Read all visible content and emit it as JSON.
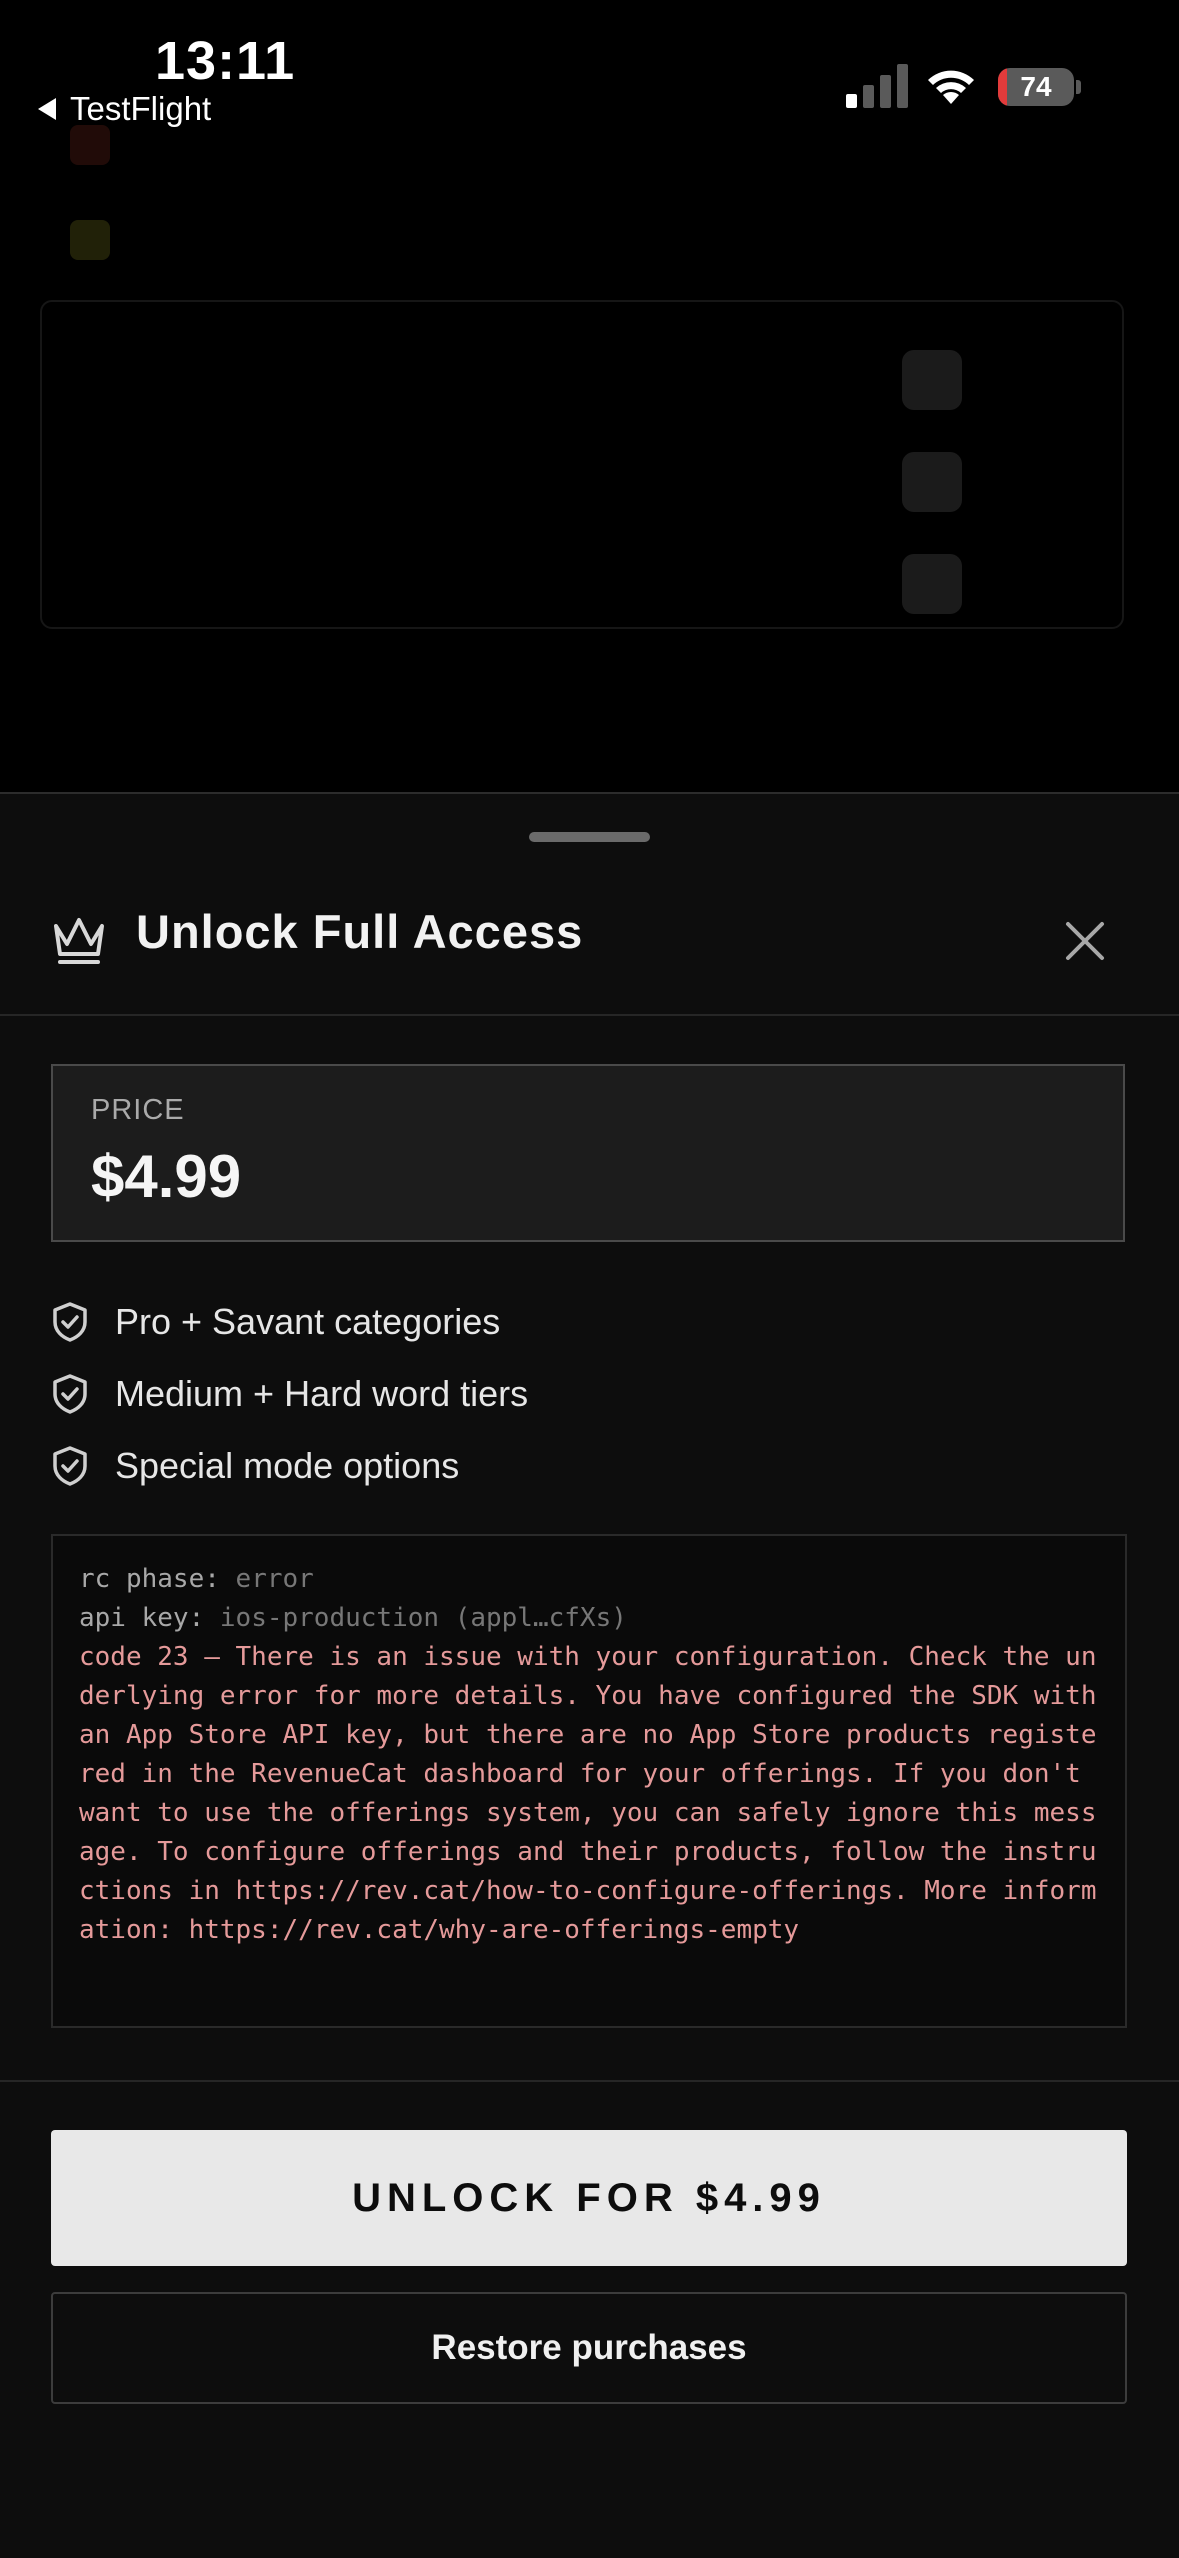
{
  "status_bar": {
    "time": "13:11",
    "back_app": "TestFlight",
    "battery_level": "74",
    "battery_fraction": 0.74,
    "icons": [
      "cellular-signal-icon",
      "wifi-icon",
      "battery-icon"
    ]
  },
  "sheet": {
    "title": "Unlock Full Access",
    "price_label": "PRICE",
    "price": "$4.99",
    "features": [
      "Pro + Savant categories",
      "Medium + Hard word tiers",
      "Special mode options"
    ],
    "debug": {
      "phase_key": "rc phase:",
      "phase_value": "error",
      "api_key_label": "api key:",
      "api_key_value": "ios-production (appl…cfXs)",
      "error_message": "code 23 — There is an issue with your configuration. Check the underlying error for more details. You have configured the SDK with an App Store API key, but there are no App Store products registered in the RevenueCat dashboard for your offerings. If you don't want to use the offerings system, you can safely ignore this message. To configure offerings and their products, follow the instructions in https://rev.cat/how-to-configure-offerings. More information: https://rev.cat/why-are-offerings-empty"
    },
    "unlock_button": "UNLOCK FOR $4.99",
    "restore_button": "Restore purchases"
  },
  "colors": {
    "background": "#000000",
    "sheet": "#0d0d0d",
    "primary_button": "#e8e8e8",
    "error_text": "#e59a9a",
    "battery_low": "#e23b3b"
  }
}
